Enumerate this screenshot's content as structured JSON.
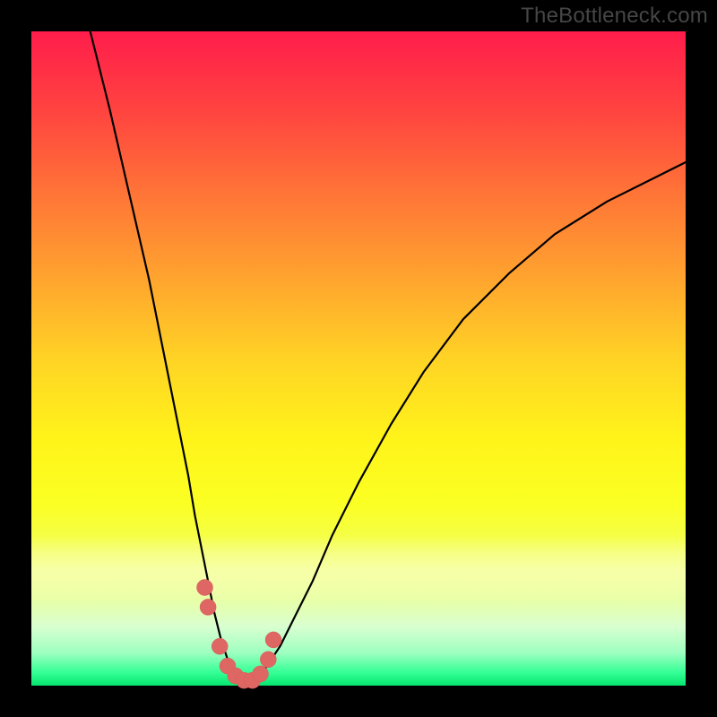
{
  "watermark": "TheBottleneck.com",
  "chart_data": {
    "type": "line",
    "title": "",
    "xlabel": "",
    "ylabel": "",
    "xlim": [
      0,
      100
    ],
    "ylim": [
      0,
      100
    ],
    "curve": {
      "x": [
        9,
        12,
        15,
        18,
        20,
        22,
        24,
        25,
        26,
        27,
        28,
        29,
        30,
        31,
        32,
        33,
        34,
        35,
        36,
        38,
        40,
        43,
        46,
        50,
        55,
        60,
        66,
        73,
        80,
        88,
        96,
        100
      ],
      "y_pct": [
        100,
        88,
        75,
        62,
        52,
        42,
        32,
        26,
        21,
        16,
        11,
        7,
        4,
        2,
        1,
        0.5,
        0.7,
        1.5,
        3,
        6,
        10,
        16,
        23,
        31,
        40,
        48,
        56,
        63,
        69,
        74,
        78,
        80
      ]
    },
    "markers": {
      "x": [
        26.5,
        27.0,
        28.8,
        30.0,
        31.2,
        32.5,
        33.8,
        35.0,
        36.2,
        37.0
      ],
      "y_pct": [
        15,
        12,
        6,
        3,
        1.5,
        0.8,
        0.8,
        1.8,
        4,
        7
      ]
    },
    "background_gradient": {
      "top": "#ff1d4b",
      "mid": "#fff31a",
      "bottom": "#06e56e"
    }
  }
}
